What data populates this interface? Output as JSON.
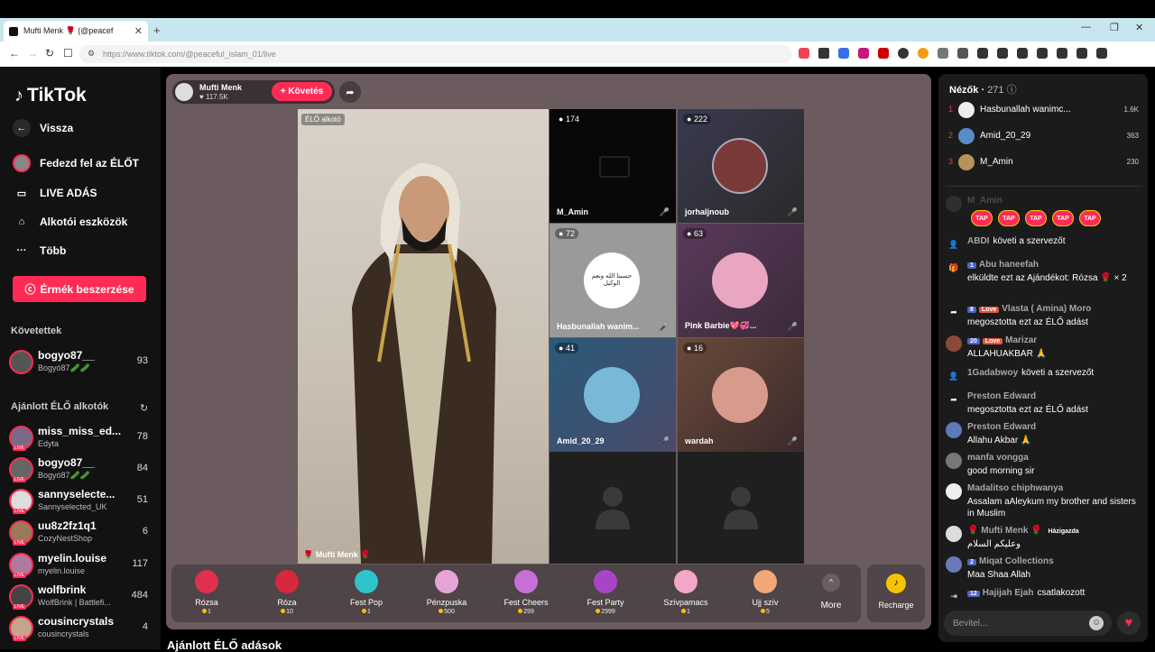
{
  "browser": {
    "tab_title": "Mufti Menk 🌹 (@peacef",
    "url": "https://www.tiktok.com/@peaceful_islam_01/live"
  },
  "sidebar": {
    "logo": "TikTok",
    "nav": [
      {
        "label": "Vissza"
      },
      {
        "label": "Fedezd fel az ÉLŐT"
      },
      {
        "label": "LIVE ADÁS"
      },
      {
        "label": "Alkotói eszközök"
      },
      {
        "label": "Több"
      }
    ],
    "coins_button": "Érmék beszerzése",
    "following_title": "Követettek",
    "following": [
      {
        "name": "bogyo87__",
        "sub": "Bogyó87🥒🥒",
        "count": "93"
      }
    ],
    "recommended_title": "Ajánlott ÉLŐ alkotók",
    "recommended": [
      {
        "name": "miss_miss_ed...",
        "sub": "Edyta",
        "count": "78"
      },
      {
        "name": "bogyo87__",
        "sub": "Bogyó87🥒🥒",
        "count": "84"
      },
      {
        "name": "sannyselecte...",
        "sub": "Sannyselected_UK",
        "count": "51"
      },
      {
        "name": "uu8z2fz1q1",
        "sub": "CozyNestShop",
        "count": "6"
      },
      {
        "name": "myelin.louise",
        "sub": "myelin.louise",
        "count": "117"
      },
      {
        "name": "wolfbrink",
        "sub": "WolfBrink | Battlefi...",
        "count": "484"
      },
      {
        "name": "cousincrystals",
        "sub": "cousincrystals",
        "count": "4"
      }
    ],
    "live_badge": "LIVE"
  },
  "live": {
    "host_name": "Mufti Menk",
    "host_likes": "117.5K",
    "follow_label": "+ Követés",
    "creator_tag": "ÉLŐ alkotó",
    "host_label": "Mufti Menk",
    "guests": [
      {
        "count": "174",
        "name": "M_Amin"
      },
      {
        "count": "222",
        "name": "jorhaljnoub"
      },
      {
        "count": "72",
        "name": "Hasbunallah wanim..."
      },
      {
        "count": "63",
        "name": "Pink Barbie💖💞..."
      },
      {
        "count": "41",
        "name": "Amid_20_29"
      },
      {
        "count": "16",
        "name": "wardah"
      }
    ],
    "arabic_snippet": "حسبنا الله ونعم الوكيل",
    "gifts": [
      {
        "name": "Rózsa",
        "price": "1",
        "color": "#e0304e"
      },
      {
        "name": "Róza",
        "price": "10",
        "color": "#d8283d"
      },
      {
        "name": "Fest Pop",
        "price": "1",
        "color": "#2ec4c9"
      },
      {
        "name": "Pénzpuska",
        "price": "500",
        "color": "#e6a3d6"
      },
      {
        "name": "Fest Cheers",
        "price": "299",
        "color": "#c76fd8"
      },
      {
        "name": "Fest Party",
        "price": "2999",
        "color": "#a645c8"
      },
      {
        "name": "Szívpamacs",
        "price": "1",
        "color": "#f2a6c8"
      },
      {
        "name": "Ujj szív",
        "price": "5",
        "color": "#f0a878"
      }
    ],
    "more_label": "More",
    "recharge_label": "Recharge"
  },
  "chat": {
    "viewers_label": "Nézők",
    "viewers_count": "271",
    "top": [
      {
        "rank": "1",
        "name": "Hasbunallah wanimc...",
        "score": "1.6K"
      },
      {
        "rank": "2",
        "name": "Amid_20_29",
        "score": "363"
      },
      {
        "rank": "3",
        "name": "M_Amin",
        "score": "230"
      }
    ],
    "faded_row": "M_Amin",
    "tap_label": "TAP",
    "messages": [
      {
        "user": "ABDI",
        "text": "követi a szervezőt"
      },
      {
        "badge": "1",
        "user": "Abu haneefah",
        "text": "elküldte ezt az Ajándékot: Rózsa 🌹 × 2"
      },
      {
        "badge": "8",
        "love": "Love",
        "user": "Vlasta ( Amina) Moro",
        "text": "megosztotta ezt az ÉLŐ adást"
      },
      {
        "badge": "20",
        "love": "Love",
        "user": "Marizar",
        "text": "ALLAHUAKBAR 🙏"
      },
      {
        "user": "1Gadabwoy",
        "text": "követi a szervezőt"
      },
      {
        "user": "Preston Edward",
        "text": "megosztotta ezt az ÉLŐ adást"
      },
      {
        "user": "Preston Edward",
        "text": "Allahu Akbar 🙏"
      },
      {
        "user": "manfa vongga",
        "text": "good morning sir"
      },
      {
        "user": "Madalitso chiphwanya",
        "text": "Assalam aAleykum my brother and sisters in Muslim"
      },
      {
        "user": "Mufti Menk",
        "host": "Házigazda",
        "text": "وعليكم السلام"
      },
      {
        "badge": "2",
        "user": "Miqat Collections",
        "text": "Maa Shaa Allah"
      },
      {
        "badge": "12",
        "user": "Hajijah Ejah",
        "text": "csatlakozott"
      }
    ],
    "input_placeholder": "Bevitel..."
  },
  "recommended_live_title": "Ajánlott ÉLŐ adások",
  "colors": {
    "accent": "#fe2c55",
    "panel": "#6b5a5e",
    "chat_bg": "#1b1b1b"
  }
}
